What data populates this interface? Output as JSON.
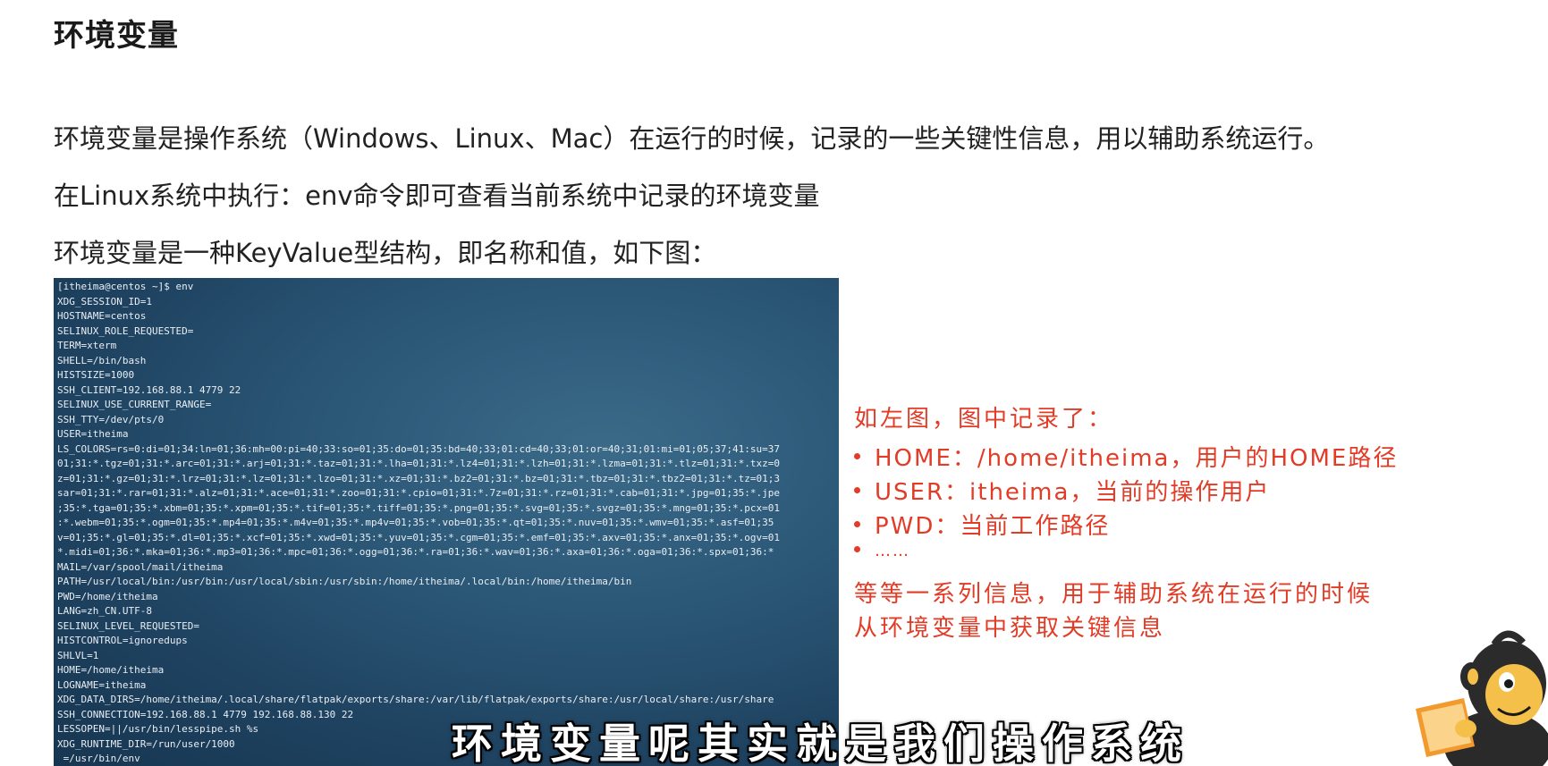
{
  "slide": {
    "title": "环境变量",
    "paragraphs": [
      "环境变量是操作系统（Windows、Linux、Mac）在运行的时候，记录的一些关键性信息，用以辅助系统运行。",
      "在Linux系统中执行：env命令即可查看当前系统中记录的环境变量",
      "环境变量是一种KeyValue型结构，即名称和值，如下图："
    ]
  },
  "terminal": {
    "lines": [
      "[itheima@centos ~]$ env",
      "XDG_SESSION_ID=1",
      "HOSTNAME=centos",
      "SELINUX_ROLE_REQUESTED=",
      "TERM=xterm",
      "SHELL=/bin/bash",
      "HISTSIZE=1000",
      "SSH_CLIENT=192.168.88.1 4779 22",
      "SELINUX_USE_CURRENT_RANGE=",
      "SSH_TTY=/dev/pts/0",
      "USER=itheima",
      "LS_COLORS=rs=0:di=01;34:ln=01;36:mh=00:pi=40;33:so=01;35:do=01;35:bd=40;33;01:cd=40;33;01:or=40;31;01:mi=01;05;37;41:su=37",
      "01;31:*.tgz=01;31:*.arc=01;31:*.arj=01;31:*.taz=01;31:*.lha=01;31:*.lz4=01;31:*.lzh=01;31:*.lzma=01;31:*.tlz=01;31:*.txz=0",
      "z=01;31:*.gz=01;31:*.lrz=01;31:*.lz=01;31:*.lzo=01;31:*.xz=01;31:*.bz2=01;31:*.bz=01;31:*.tbz=01;31:*.tbz2=01;31:*.tz=01;3",
      "sar=01;31:*.rar=01;31:*.alz=01;31:*.ace=01;31:*.zoo=01;31:*.cpio=01;31:*.7z=01;31:*.rz=01;31:*.cab=01;31:*.jpg=01;35:*.jpe",
      ";35:*.tga=01;35:*.xbm=01;35:*.xpm=01;35:*.tif=01;35:*.tiff=01;35:*.png=01;35:*.svg=01;35:*.svgz=01;35:*.mng=01;35:*.pcx=01",
      ":*.webm=01;35:*.ogm=01;35:*.mp4=01;35:*.m4v=01;35:*.mp4v=01;35:*.vob=01;35:*.qt=01;35:*.nuv=01;35:*.wmv=01;35:*.asf=01;35",
      "v=01;35:*.gl=01;35:*.dl=01;35:*.xcf=01;35:*.xwd=01;35:*.yuv=01;35:*.cgm=01;35:*.emf=01;35:*.axv=01;35:*.anx=01;35:*.ogv=01",
      "*.midi=01;36:*.mka=01;36:*.mp3=01;36:*.mpc=01;36:*.ogg=01;36:*.ra=01;36:*.wav=01;36:*.axa=01;36:*.oga=01;36:*.spx=01;36:*",
      "MAIL=/var/spool/mail/itheima",
      "PATH=/usr/local/bin:/usr/bin:/usr/local/sbin:/usr/sbin:/home/itheima/.local/bin:/home/itheima/bin",
      "PWD=/home/itheima",
      "LANG=zh_CN.UTF-8",
      "SELINUX_LEVEL_REQUESTED=",
      "HISTCONTROL=ignoredups",
      "SHLVL=1",
      "HOME=/home/itheima",
      "LOGNAME=itheima",
      "XDG_DATA_DIRS=/home/itheima/.local/share/flatpak/exports/share:/var/lib/flatpak/exports/share:/usr/local/share:/usr/share",
      "SSH_CONNECTION=192.168.88.1 4779 192.168.88.130 22",
      "LESSOPEN=||/usr/bin/lesspipe.sh %s",
      "XDG_RUNTIME_DIR=/run/user/1000",
      " =/usr/bin/env"
    ]
  },
  "notes": {
    "intro": "如左图，图中记录了：",
    "bullets": [
      "HOME：/home/itheima，用户的HOME路径",
      "USER：itheima，当前的操作用户",
      "PWD：当前工作路径",
      "……"
    ],
    "outro_line1": "等等一系列信息，用于辅助系统在运行的时候",
    "outro_line2": "从环境变量中获取关键信息",
    "color": "#e23b26"
  },
  "subtitle": "环境变量呢其实就是我们操作系统",
  "mascot": {
    "icon": "monkey-mascot-icon"
  }
}
